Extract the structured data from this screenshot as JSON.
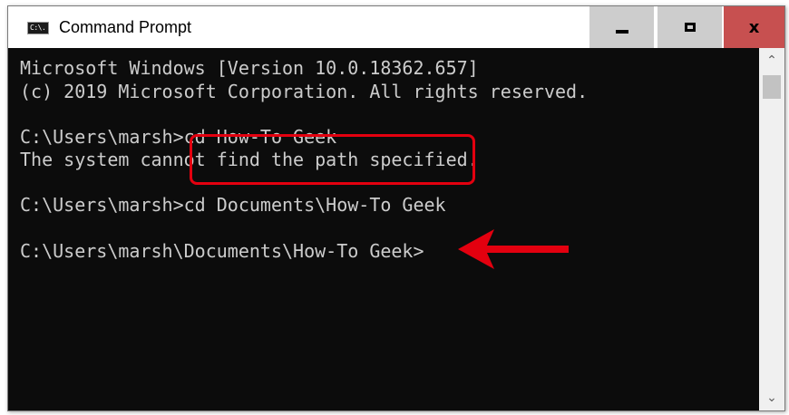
{
  "window": {
    "title": "Command Prompt",
    "icon_label": "C:\\.",
    "buttons": {
      "minimize": "minimize-icon",
      "maximize": "maximize-icon",
      "close": "close-icon"
    }
  },
  "console": {
    "lines": [
      "Microsoft Windows [Version 10.0.18362.657]",
      "(c) 2019 Microsoft Corporation. All rights reserved.",
      "",
      "C:\\Users\\marsh>cd How-To Geek",
      "The system cannot find the path specified.",
      "",
      "C:\\Users\\marsh>cd Documents\\How-To Geek",
      "",
      "C:\\Users\\marsh\\Documents\\How-To Geek>"
    ],
    "text_color": "#cccccc",
    "background": "#0c0c0c"
  },
  "annotations": {
    "highlight_color": "#e3000f",
    "arrow_color": "#e3000f"
  }
}
